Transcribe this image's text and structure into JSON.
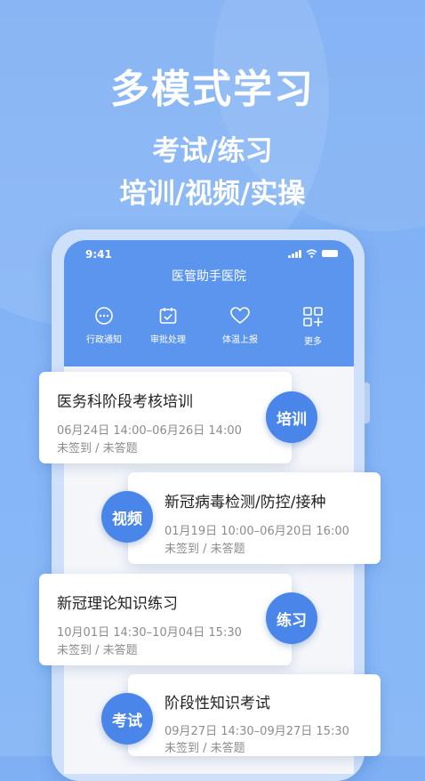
{
  "headline": {
    "main": "多模式学习",
    "line2": "考试/练习",
    "line3": "培训/视频/实操"
  },
  "phone": {
    "status_time": "9:41",
    "app_title": "医管助手医院",
    "quick_actions": [
      {
        "label": "行政通知",
        "icon": "chat-bubble-icon"
      },
      {
        "label": "审批处理",
        "icon": "calendar-check-icon"
      },
      {
        "label": "体温上报",
        "icon": "heart-icon"
      },
      {
        "label": "更多",
        "icon": "grid-plus-icon"
      }
    ]
  },
  "cards": [
    {
      "badge": "培训",
      "title": "医务科阶段考核培训",
      "time": "06月24日 14:00–06月26日 14:00",
      "status": "未签到 / 未答题"
    },
    {
      "badge": "视频",
      "title": "新冠病毒检测/防控/接种",
      "time": "01月19日 10:00–06月20日 16:00",
      "status": "未签到 / 未答题"
    },
    {
      "badge": "练习",
      "title": "新冠理论知识练习",
      "time": "10月01日 14:30–10月04日 15:30",
      "status": "未签到 / 未答题"
    },
    {
      "badge": "考试",
      "title": "阶段性知识考试",
      "time": "09月27日 14:30–09月27日 15:30",
      "status": "未签到 / 未答题"
    }
  ],
  "colors": {
    "background": "#7cadf3",
    "header_blue": "#5b95ee",
    "badge_blue": "#4a86ea"
  }
}
